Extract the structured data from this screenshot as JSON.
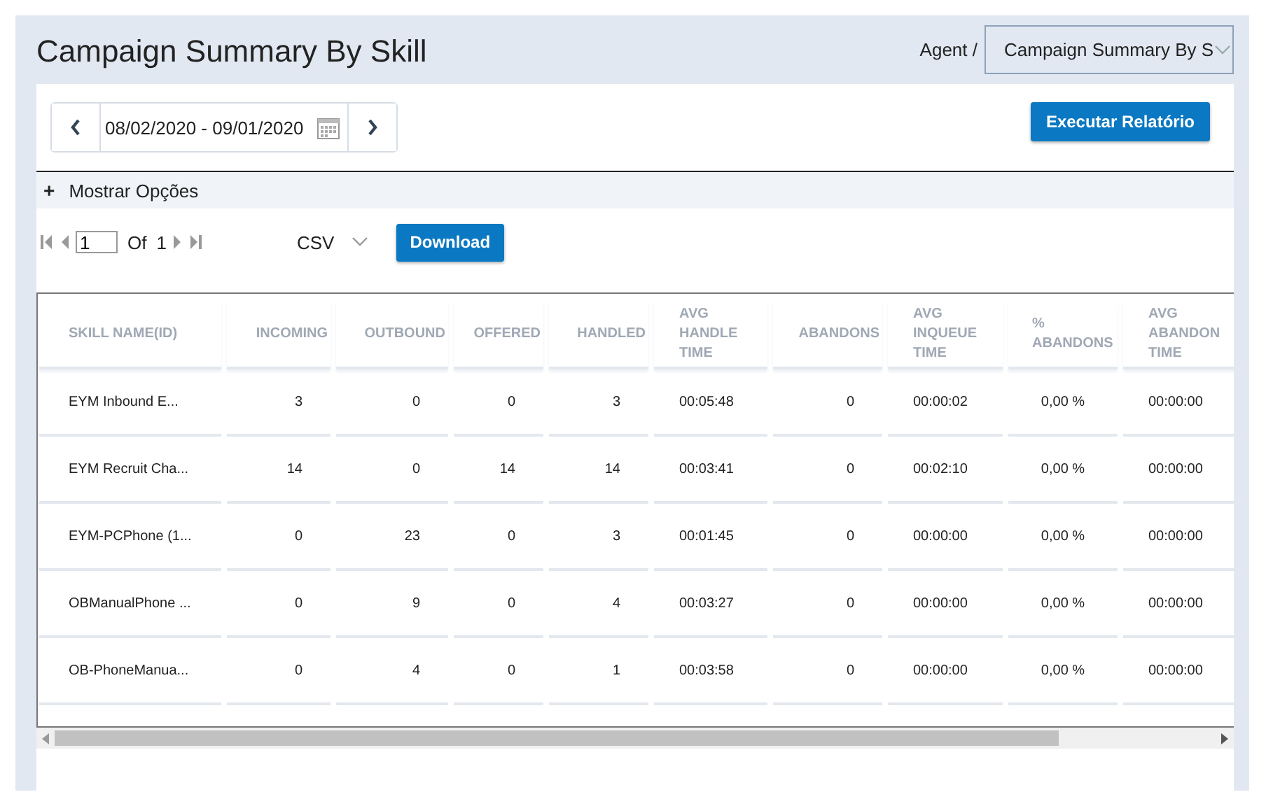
{
  "header": {
    "title": "Campaign Summary By Skill",
    "breadcrumb": "Agent /",
    "report_select": "Campaign Summary By S"
  },
  "toolbar": {
    "date_range": "08/02/2020 - 09/01/2020",
    "run_button": "Executar Relatório"
  },
  "options_toggle": {
    "icon": "+",
    "label": "Mostrar Opções"
  },
  "pager": {
    "page": "1",
    "of_label": "Of",
    "total": "1",
    "format": "CSV",
    "download_button": "Download"
  },
  "table": {
    "columns": [
      "SKILL NAME(ID)",
      "INCOMING",
      "OUTBOUND",
      "OFFERED",
      "HANDLED",
      "AVG\nHANDLE\nTIME",
      "ABANDONS",
      "AVG\nINQUEUE\nTIME",
      "%\nABANDONS",
      "AVG\nABANDON\nTIME"
    ],
    "rows": [
      [
        "EYM Inbound E...",
        "3",
        "0",
        "0",
        "3",
        "00:05:48",
        "0",
        "00:00:02",
        "0,00 %",
        "00:00:00"
      ],
      [
        "EYM Recruit Cha...",
        "14",
        "0",
        "14",
        "14",
        "00:03:41",
        "0",
        "00:02:10",
        "0,00 %",
        "00:00:00"
      ],
      [
        "EYM-PCPhone (1...",
        "0",
        "23",
        "0",
        "3",
        "00:01:45",
        "0",
        "00:00:00",
        "0,00 %",
        "00:00:00"
      ],
      [
        "OBManualPhone ...",
        "0",
        "9",
        "0",
        "4",
        "00:03:27",
        "0",
        "00:00:00",
        "0,00 %",
        "00:00:00"
      ],
      [
        "OB-PhoneManua...",
        "0",
        "4",
        "0",
        "1",
        "00:03:58",
        "0",
        "00:00:00",
        "0,00 %",
        "00:00:00"
      ]
    ]
  }
}
